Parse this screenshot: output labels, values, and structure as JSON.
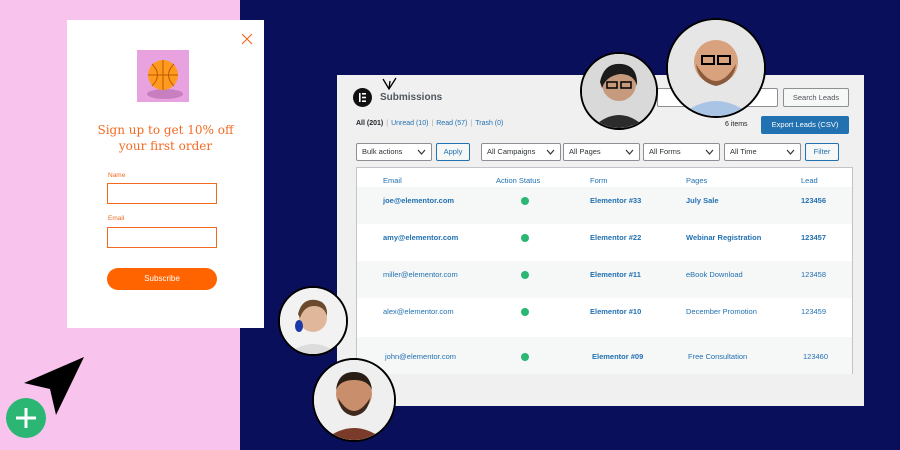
{
  "popup": {
    "title": "Sign up to get 10% off your first order",
    "name_label": "Name",
    "email_label": "Email",
    "subscribe_label": "Subscribe",
    "name_value": "",
    "email_value": ""
  },
  "panel": {
    "title": "Submissions",
    "search_button": "Search Leads",
    "tabs": {
      "all": "All (201)",
      "unread": "Unread (10)",
      "read": "Read (57)",
      "trash": "Trash (0)"
    },
    "items_count": "6 items",
    "export_button": "Export Leads (CSV)",
    "bulk_actions": "Bulk actions",
    "apply_button": "Apply",
    "campaigns": "All Campaigns",
    "pages": "All Pages",
    "forms": "All Forms",
    "time": "All Time",
    "filter_button": "Filter"
  },
  "table": {
    "headers": [
      "Email",
      "Action Status",
      "Form",
      "Pages",
      "Lead"
    ],
    "rows": [
      {
        "email": "joe@elementor.com",
        "form": "Elementor #33",
        "page": "July Sale",
        "lead": "123456"
      },
      {
        "email": "amy@elementor.com",
        "form": "Elementor #22",
        "page": "Webinar Registration",
        "lead": "123457"
      },
      {
        "email": "miller@elementor.com",
        "form": "Elementor #11",
        "page": "eBook Download",
        "lead": "123458"
      },
      {
        "email": "alex@elementor.com",
        "form": "Elementor #10",
        "page": "December Promotion",
        "lead": "123459"
      },
      {
        "email": "john@elementor.com",
        "form": "Elementor #09",
        "page": "Free Consultation",
        "lead": "123460"
      }
    ]
  },
  "colors": {
    "navy": "#0a0f5c",
    "pink": "#f8c4ee",
    "orange": "#f26a21",
    "wp_blue": "#2271b1",
    "green": "#2bb673"
  }
}
